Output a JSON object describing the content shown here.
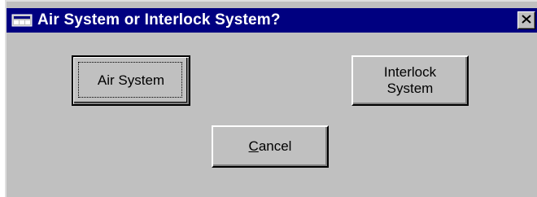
{
  "window": {
    "title": "Air System or Interlock System?",
    "icon": "app-window-icon",
    "close_icon": "close-x-icon"
  },
  "buttons": {
    "air": {
      "label": "Air System",
      "default": true
    },
    "interlock": {
      "label": "Interlock\nSystem"
    },
    "cancel": {
      "mnemonic": "C",
      "rest": "ancel"
    }
  },
  "colors": {
    "titlebar": "#000080",
    "face": "#c0c0c0",
    "title_text": "#ffffff"
  }
}
